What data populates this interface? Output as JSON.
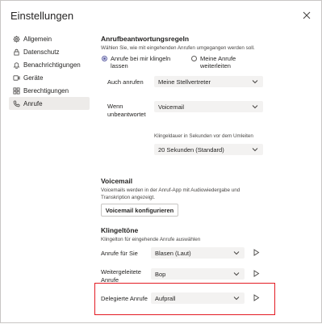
{
  "dialog": {
    "title": "Einstellungen"
  },
  "sidebar": {
    "items": [
      {
        "label": "Allgemein",
        "icon": "gear-icon"
      },
      {
        "label": "Datenschutz",
        "icon": "lock-icon"
      },
      {
        "label": "Benachrichtigungen",
        "icon": "bell-icon"
      },
      {
        "label": "Geräte",
        "icon": "device-icon"
      },
      {
        "label": "Berechtigungen",
        "icon": "grid-icon"
      },
      {
        "label": "Anrufe",
        "icon": "phone-icon",
        "active": true
      }
    ]
  },
  "answer_rules": {
    "heading": "Anrufbeantwortungsregeln",
    "description": "Wählen Sie, wie mit eingehenden Anrufen umgegangen werden soll.",
    "option_ring": "Anrufe bei mir klingeln lassen",
    "option_forward": "Meine Anrufe weiterleiten",
    "also_call_label": "Auch anrufen",
    "also_call_value": "Meine Stellvertreter",
    "unanswered_label": "Wenn unbeantwortet",
    "unanswered_value": "Voicemail",
    "ring_duration_label": "Klingeldauer in Sekunden vor dem Umleiten",
    "ring_duration_value": "20 Sekunden (Standard)"
  },
  "voicemail": {
    "heading": "Voicemail",
    "description": "Voicemails werden in der Anruf-App mit Audiowiedergabe und Transkription angezeigt.",
    "configure_button": "Voicemail konfigurieren"
  },
  "ringtones": {
    "heading": "Klingeltöne",
    "description": "Klingelton für eingehende Anrufe auswählen",
    "rows": [
      {
        "label": "Anrufe für Sie",
        "value": "Blasen (Laut)"
      },
      {
        "label": "Weitergeleitete Anrufe",
        "value": "Bop"
      },
      {
        "label": "Delegierte Anrufe",
        "value": "Aufprall"
      }
    ]
  },
  "colors": {
    "accent": "#6264a7",
    "highlight": "#e31b23"
  }
}
